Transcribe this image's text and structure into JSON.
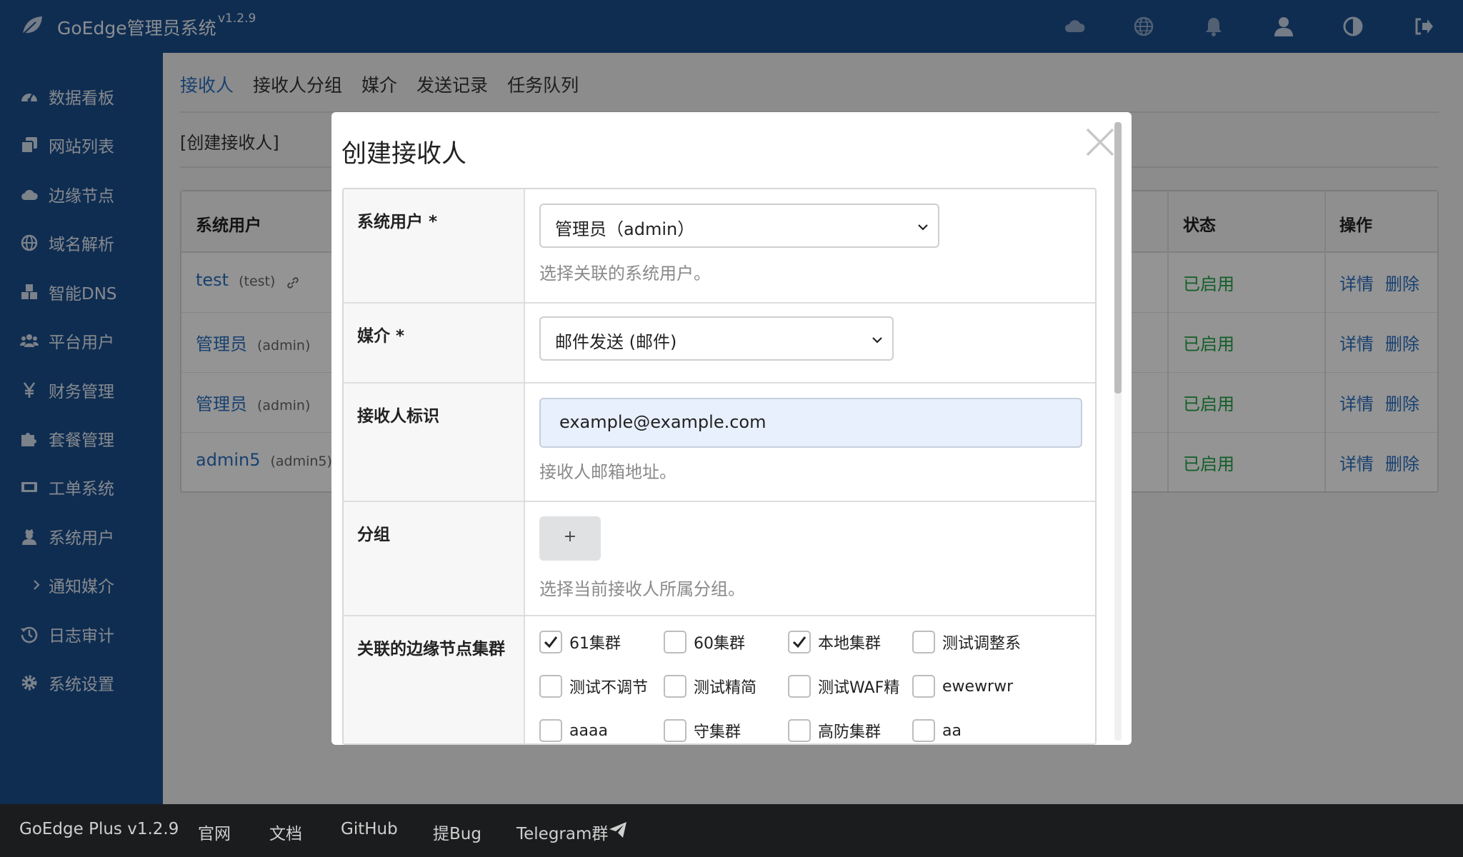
{
  "header": {
    "title": "GoEdge管理员系统",
    "version": "v1.2.9",
    "icons": [
      "cloud-icon",
      "globe-icon",
      "bell-icon",
      "user-icon",
      "contrast-icon",
      "logout-icon"
    ]
  },
  "sidebar": {
    "items": [
      {
        "label": "数据看板",
        "icon": "dashboard-icon"
      },
      {
        "label": "网站列表",
        "icon": "clone-icon"
      },
      {
        "label": "边缘节点",
        "icon": "cloud-icon"
      },
      {
        "label": "域名解析",
        "icon": "globe-icon"
      },
      {
        "label": "智能DNS",
        "icon": "cubes-icon"
      },
      {
        "label": "平台用户",
        "icon": "users-icon"
      },
      {
        "label": "财务管理",
        "icon": "yen-icon"
      },
      {
        "label": "套餐管理",
        "icon": "puzzle-icon"
      },
      {
        "label": "工单系统",
        "icon": "ticket-icon"
      },
      {
        "label": "系统用户",
        "icon": "user-secret-icon"
      },
      {
        "label": "通知媒介",
        "icon": "chevron-right-icon"
      },
      {
        "label": "日志审计",
        "icon": "history-icon"
      },
      {
        "label": "系统设置",
        "icon": "gear-icon"
      }
    ]
  },
  "main": {
    "tabs": [
      "接收人",
      "接收人分组",
      "媒介",
      "发送记录",
      "任务队列"
    ],
    "create_link": "[创建接收人]",
    "table": {
      "headers": {
        "user": "系统用户",
        "status": "状态",
        "ops": "操作"
      },
      "rows": [
        {
          "name": "test",
          "login": "(test)",
          "status": "已启用"
        },
        {
          "name": "管理员",
          "login": "(admin)",
          "status": "已启用"
        },
        {
          "name": "管理员",
          "login": "(admin)",
          "status": "已启用"
        },
        {
          "name": "admin5",
          "login": "(admin5)",
          "status": "已启用"
        }
      ],
      "op_detail": "详情",
      "op_delete": "删除"
    }
  },
  "modal": {
    "title": "创建接收人",
    "fields": {
      "system_user": {
        "label": "系统用户 *",
        "value": "管理员（admin）",
        "hint": "选择关联的系统用户。"
      },
      "media": {
        "label": "媒介 *",
        "value": "邮件发送 (邮件)"
      },
      "receiver_id": {
        "label": "接收人标识",
        "value": "example@example.com",
        "hint": "接收人邮箱地址。"
      },
      "group": {
        "label": "分组",
        "add_label": "+",
        "hint": "选择当前接收人所属分组。"
      },
      "clusters": {
        "label": "关联的边缘节点集群",
        "options": [
          {
            "label": "61集群",
            "checked": true
          },
          {
            "label": "60集群",
            "checked": false
          },
          {
            "label": "本地集群",
            "checked": true
          },
          {
            "label": "测试调整系",
            "checked": false
          },
          {
            "label": "测试不调节",
            "checked": false
          },
          {
            "label": "测试精简",
            "checked": false
          },
          {
            "label": "测试WAF精",
            "checked": false
          },
          {
            "label": "ewewrwr",
            "checked": false
          },
          {
            "label": "aaaa",
            "checked": false
          },
          {
            "label": "守集群",
            "checked": false
          },
          {
            "label": "高防集群",
            "checked": false
          },
          {
            "label": "aa",
            "checked": false
          }
        ]
      }
    }
  },
  "footer": {
    "links": [
      "GoEdge Plus v1.2.9",
      "官网",
      "文档",
      "GitHub",
      "提Bug",
      "Telegram群"
    ]
  },
  "colors": {
    "primary": "#1b4e8c",
    "link": "#2a70c2",
    "success": "#21a345",
    "footer": "#1b1c1d"
  }
}
